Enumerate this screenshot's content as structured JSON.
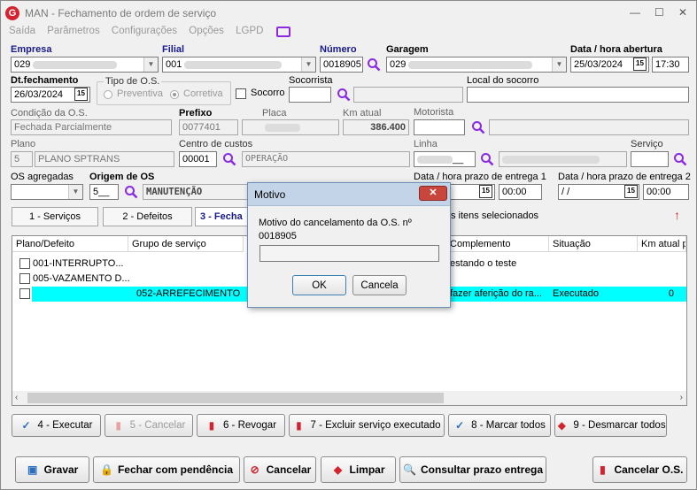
{
  "window": {
    "title": "MAN - Fechamento de ordem de serviço",
    "logo": "G",
    "min": "—",
    "max": "☐",
    "close": "✕"
  },
  "menu": [
    "Saída",
    "Parâmetros",
    "Configurações",
    "Opções",
    "LGPD"
  ],
  "fields": {
    "empresa_label": "Empresa",
    "empresa_value": "029",
    "filial_label": "Filial",
    "filial_value": "001",
    "numero_label": "Número",
    "numero_value": "0018905",
    "garagem_label": "Garagem",
    "garagem_value": "029",
    "abertura_label": "Data / hora abertura",
    "abertura_date": "25/03/2024",
    "abertura_time": "17:30",
    "dtfech_label": "Dt.fechamento",
    "dtfech_value": "26/03/2024",
    "tipo_label": "Tipo de O.S.",
    "preventiva": "Preventiva",
    "corretiva": "Corretiva",
    "socorro_label": "Socorro",
    "socorrista_label": "Socorrista",
    "local_label": "Local do socorro",
    "condicao_label": "Condição da O.S.",
    "condicao_value": "Fechada Parcialmente",
    "prefixo_label": "Prefixo",
    "prefixo_value": "0077401",
    "placa_label": "Placa",
    "km_label": "Km atual",
    "km_value": "386.400",
    "motorista_label": "Motorista",
    "plano_label": "Plano",
    "plano_code": "5",
    "plano_value": "PLANO SPTRANS",
    "centro_label": "Centro de custos",
    "centro_code": "00001",
    "centro_value": "OPERAÇÃO",
    "linha_label": "Linha",
    "linha_code": "__",
    "servico_label": "Serviço",
    "agregadas_label": "OS agregadas",
    "origem_label": "Origem de OS",
    "origem_code": "5__",
    "origem_value": "MANUTENÇÃO",
    "prazo1_label": "Data / hora prazo de entrega 1",
    "prazo1_time": "00:00",
    "prazo2_label": "Data / hora prazo de entrega 2",
    "prazo2_date": " /  /",
    "prazo2_time": "00:00"
  },
  "tabs": [
    "1 - Serviços",
    "2 - Defeitos",
    "3 - Fecha"
  ],
  "selected_note": "s itens selecionados",
  "grid": {
    "headers": [
      "Plano/Defeito",
      "Grupo de serviço",
      "Complemento",
      "Situação",
      "Km atual pl"
    ],
    "rows": [
      {
        "plano": "001-INTERRUPTO...",
        "grupo": "",
        "complemento": "estando o teste",
        "situacao": "",
        "km": ""
      },
      {
        "plano": "005-VAZAMENTO D...",
        "grupo": "",
        "complemento": "",
        "situacao": "",
        "km": ""
      },
      {
        "plano": "",
        "grupo": "052-ARREFECIMENTO",
        "complemento": "fazer aferição do ra...",
        "situacao": "Executado",
        "km": "0"
      }
    ]
  },
  "actions": {
    "executar": "4 - Executar",
    "cancelar": "5 - Cancelar",
    "revogar": "6 - Revogar",
    "excluir": "7 - Excluir serviço executado",
    "marcar": "8 - Marcar todos",
    "desmarcar": "9 - Desmarcar todos"
  },
  "bottom": {
    "gravar": "Gravar",
    "pendencia": "Fechar com pendência",
    "cancelar": "Cancelar",
    "limpar": "Limpar",
    "consultar": "Consultar prazo entrega",
    "cancelar_os": "Cancelar O.S."
  },
  "dialog": {
    "title": "Motivo",
    "close": "✕",
    "message": "Motivo do cancelamento da O.S. nº 0018905",
    "input": "",
    "ok": "OK",
    "cancel": "Cancela"
  },
  "colors": {
    "accent": "#1a1a8c",
    "selected_row": "#00ffff",
    "danger": "#d4232e"
  }
}
